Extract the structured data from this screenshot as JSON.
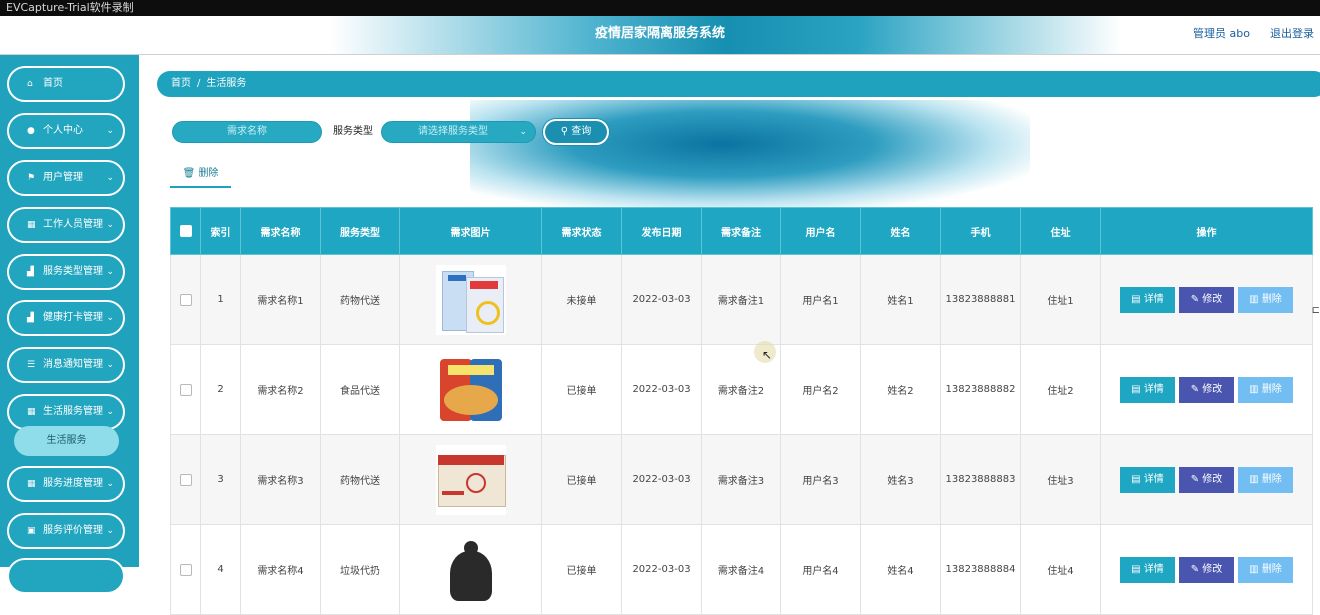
{
  "window": {
    "titlebar_text": "EVCapture-Trial软件录制"
  },
  "header": {
    "title": "疫情居家隔离服务系统",
    "admin_label": "管理员 abo",
    "logout": "退出登录"
  },
  "sidebar": {
    "items": [
      {
        "label": "首页",
        "icon": "home-icon",
        "has_chevron": false
      },
      {
        "label": "个人中心",
        "icon": "user-icon",
        "has_chevron": true
      },
      {
        "label": "用户管理",
        "icon": "flag-icon",
        "has_chevron": true
      },
      {
        "label": "工作人员管理",
        "icon": "grid-icon",
        "has_chevron": true
      },
      {
        "label": "服务类型管理",
        "icon": "chart-icon",
        "has_chevron": true
      },
      {
        "label": "健康打卡管理",
        "icon": "chart-icon",
        "has_chevron": true
      },
      {
        "label": "消息通知管理",
        "icon": "list-icon",
        "has_chevron": true
      },
      {
        "label": "生活服务管理",
        "icon": "grid-icon",
        "has_chevron": true
      },
      {
        "label": "服务进度管理",
        "icon": "grid-icon",
        "has_chevron": true
      },
      {
        "label": "服务评价管理",
        "icon": "lock-icon",
        "has_chevron": true
      }
    ],
    "active_sub_item": "生活服务"
  },
  "breadcrumb": {
    "home": "首页",
    "separator": "/",
    "current": "生活服务"
  },
  "search": {
    "name_placeholder": "需求名称",
    "type_label": "服务类型",
    "type_placeholder": "请选择服务类型",
    "query_button": "查询"
  },
  "toolbar": {
    "delete_tab": "删除"
  },
  "table": {
    "headers": [
      "",
      "索引",
      "需求名称",
      "服务类型",
      "需求图片",
      "需求状态",
      "发布日期",
      "需求备注",
      "用户名",
      "姓名",
      "手机",
      "住址",
      "操作"
    ],
    "actions": {
      "detail": "详情",
      "edit": "修改",
      "delete": "删除"
    },
    "rows": [
      {
        "index": "1",
        "name": "需求名称1",
        "type": "药物代送",
        "image": "medicine-box",
        "status": "未接单",
        "date": "2022-03-03",
        "note": "需求备注1",
        "username": "用户名1",
        "realname": "姓名1",
        "phone": "13823888881",
        "address": "住址1"
      },
      {
        "index": "2",
        "name": "需求名称2",
        "type": "食品代送",
        "image": "snack-bag",
        "status": "已接单",
        "date": "2022-03-03",
        "note": "需求备注2",
        "username": "用户名2",
        "realname": "姓名2",
        "phone": "13823888882",
        "address": "住址2"
      },
      {
        "index": "3",
        "name": "需求名称3",
        "type": "药物代送",
        "image": "medicine-carton",
        "status": "已接单",
        "date": "2022-03-03",
        "note": "需求备注3",
        "username": "用户名3",
        "realname": "姓名3",
        "phone": "13823888883",
        "address": "住址3"
      },
      {
        "index": "4",
        "name": "需求名称4",
        "type": "垃圾代扔",
        "image": "garbage-bag",
        "status": "已接单",
        "date": "2022-03-03",
        "note": "需求备注4",
        "username": "用户名4",
        "realname": "姓名4",
        "phone": "13823888884",
        "address": "住址4"
      }
    ]
  },
  "colors": {
    "primary": "#1ea6c2",
    "edit": "#4a55b0",
    "delete": "#72bdf2",
    "sidebar": "#20a2bd"
  }
}
